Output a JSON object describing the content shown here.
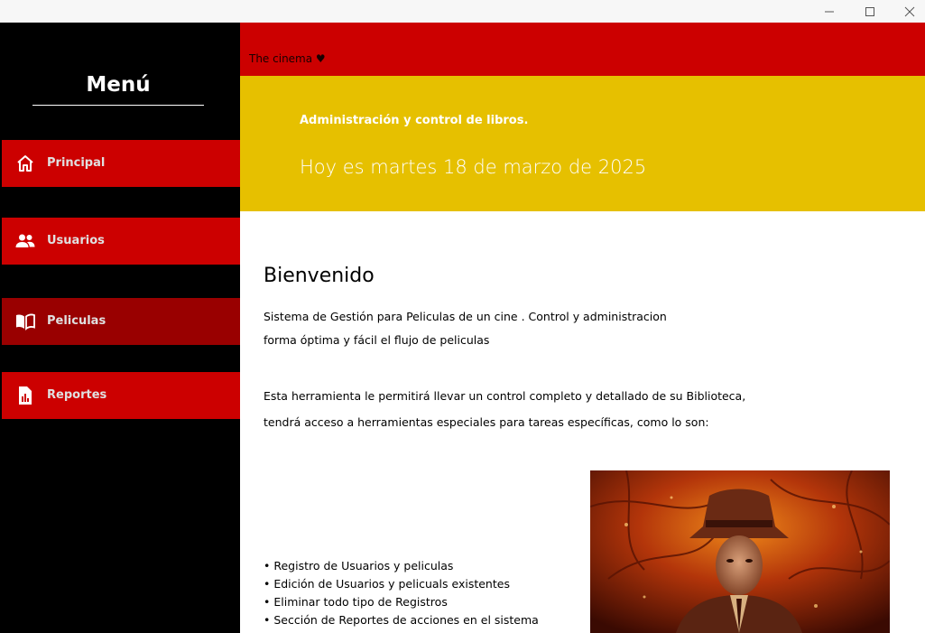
{
  "window": {
    "controls": [
      "minimize-icon",
      "maximize-icon",
      "close-icon"
    ]
  },
  "sidebar": {
    "title": "Menú",
    "items": [
      {
        "label": "Principal",
        "icon": "home-icon",
        "active": false
      },
      {
        "label": "Usuarios",
        "icon": "users-icon",
        "active": false
      },
      {
        "label": "Peliculas",
        "icon": "book-open-icon",
        "active": true
      },
      {
        "label": "Reportes",
        "icon": "report-icon",
        "active": false
      }
    ]
  },
  "header": {
    "brand": "The cinema ♥",
    "subtitle": "Administración y control de libros.",
    "date": "Hoy es martes 18 de marzo de 2025"
  },
  "main": {
    "welcome": "Bienvenido",
    "intro_line1": "Sistema de Gestión para Peliculas de un cine . Control y administracion",
    "intro_line2": "forma óptima y fácil el flujo de peliculas",
    "tools_line1": "Esta herramienta le permitirá llevar un control completo y detallado de su Biblioteca,",
    "tools_line2": "tendrá acceso a herramientas especiales para tareas específicas, como lo son:",
    "bullets": [
      "• Registro de Usuarios y peliculas",
      "• Edición de Usuarios y pelicuals existentes",
      "• Eliminar todo tipo de Registros",
      "• Sección de Reportes de acciones en el sistema"
    ]
  },
  "colors": {
    "sidebar_bg": "#000000",
    "nav_red": "#cc0000",
    "nav_active": "#990000",
    "banner_yellow": "#e6c000",
    "topbar_red": "#cc0000"
  }
}
